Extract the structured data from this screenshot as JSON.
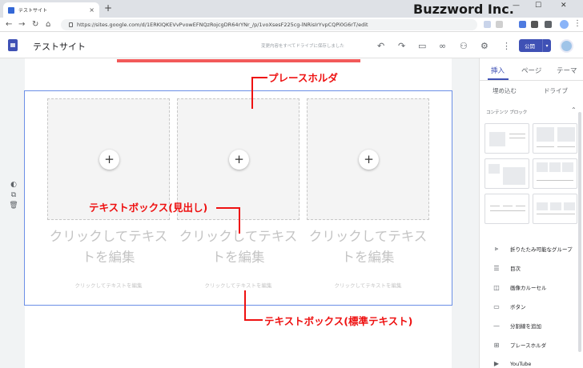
{
  "browser": {
    "tab_title": "テストサイト",
    "url": "https://sites.google.com/d/1ERKIQKEVvPvowEFNQzRojcgDR64rYNr_/p/1voXsesF225cg-lNRisIrYvpCQPi0G6rT/edit"
  },
  "watermark": "Buzzword Inc.",
  "header": {
    "site_name": "テストサイト",
    "save_message": "変更内容をすべてドライブに保存しました",
    "publish_label": "公開"
  },
  "columns": [
    {
      "heading": "クリックしてテキストを編集",
      "body": "クリックしてテキストを編集"
    },
    {
      "heading": "クリックしてテキストを編集",
      "body": "クリックしてテキストを編集"
    },
    {
      "heading": "クリックしてテキストを編集",
      "body": "クリックしてテキストを編集"
    }
  ],
  "annotations": {
    "placeholder": "プレースホルダ",
    "heading_box": "テキストボックス(見出し)",
    "body_box": "テキストボックス(標準テキスト)"
  },
  "panel": {
    "tabs": [
      "挿入",
      "ページ",
      "テーマ"
    ],
    "embed_label": "埋め込む",
    "drive_label": "ドライブ",
    "content_blocks_label": "コンテンツ ブロック",
    "items": [
      {
        "icon": "collapsible-group-icon",
        "label": "折りたたみ可能なグループ"
      },
      {
        "icon": "toc-icon",
        "label": "目次"
      },
      {
        "icon": "carousel-icon",
        "label": "画像カルーセル"
      },
      {
        "icon": "button-icon",
        "label": "ボタン"
      },
      {
        "icon": "divider-icon",
        "label": "分割線を追加"
      },
      {
        "icon": "placeholder-icon",
        "label": "プレースホルダ"
      },
      {
        "icon": "youtube-icon",
        "label": "YouTube"
      }
    ]
  },
  "colors": {
    "accent": "#3f51b5",
    "annotation": "#ee1111",
    "selection": "#6b8fe6"
  }
}
